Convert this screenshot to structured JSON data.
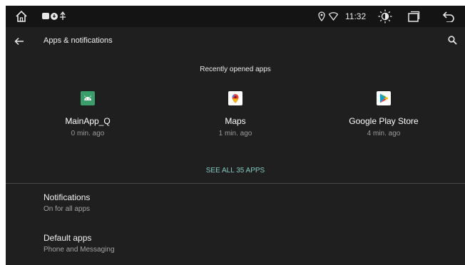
{
  "status_bar": {
    "clock": "11:32",
    "icons": [
      "home-icon",
      "notification-icons",
      "location-icon",
      "wifi-icon",
      "brightness-icon",
      "recent-apps-icon",
      "back-icon"
    ]
  },
  "app_bar": {
    "title": "Apps & notifications",
    "icons": [
      "back-arrow-icon",
      "search-icon"
    ]
  },
  "recent": {
    "header": "Recently opened apps",
    "apps": [
      {
        "name": "MainApp_Q",
        "time": "0 min. ago",
        "icon": "android-app-icon"
      },
      {
        "name": "Maps",
        "time": "1 min. ago",
        "icon": "maps-icon"
      },
      {
        "name": "Google Play Store",
        "time": "4 min. ago",
        "icon": "play-store-icon"
      }
    ],
    "see_all": "SEE ALL 35 APPS"
  },
  "settings": [
    {
      "title": "Notifications",
      "subtitle": "On for all apps"
    },
    {
      "title": "Default apps",
      "subtitle": "Phone and Messaging"
    }
  ],
  "colors": {
    "background": "#1f1f1f",
    "status_bar": "#141414",
    "accent": "#84c9c0"
  }
}
